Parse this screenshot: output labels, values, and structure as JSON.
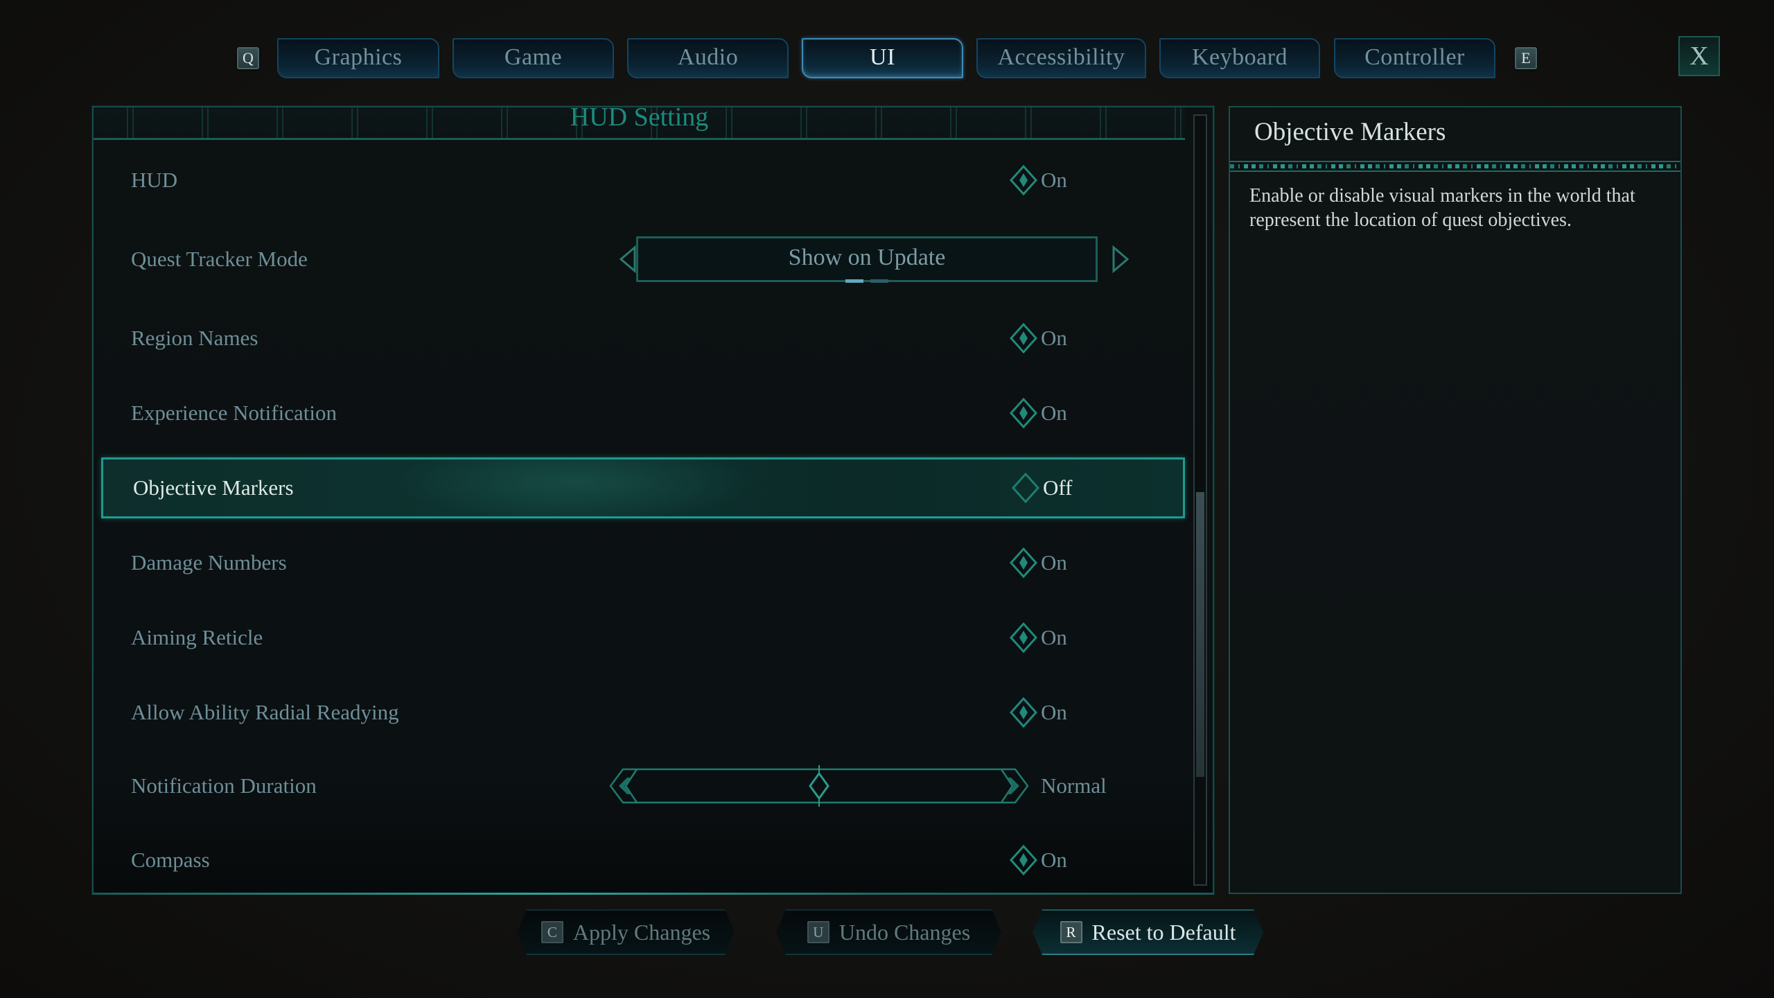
{
  "tabs": {
    "prev_key": "Q",
    "next_key": "E",
    "items": [
      {
        "label": "Graphics",
        "active": false
      },
      {
        "label": "Game",
        "active": false
      },
      {
        "label": "Audio",
        "active": false
      },
      {
        "label": "UI",
        "active": true
      },
      {
        "label": "Accessibility",
        "active": false
      },
      {
        "label": "Keyboard",
        "active": false
      },
      {
        "label": "Controller",
        "active": false
      }
    ],
    "close_label": "X"
  },
  "settings_panel": {
    "section_title": "HUD Setting",
    "rows": [
      {
        "label": "HUD",
        "type": "toggle",
        "value": "On",
        "selected": false
      },
      {
        "label": "Quest Tracker Mode",
        "type": "selector",
        "value": "Show on Update",
        "option_index": 1,
        "option_count": 2,
        "selected": false
      },
      {
        "label": "Region Names",
        "type": "toggle",
        "value": "On",
        "selected": false
      },
      {
        "label": "Experience Notification",
        "type": "toggle",
        "value": "On",
        "selected": false
      },
      {
        "label": "Objective Markers",
        "type": "toggle",
        "value": "Off",
        "selected": true
      },
      {
        "label": "Damage Numbers",
        "type": "toggle",
        "value": "On",
        "selected": false
      },
      {
        "label": "Aiming Reticle",
        "type": "toggle",
        "value": "On",
        "selected": false
      },
      {
        "label": "Allow Ability Radial Readying",
        "type": "toggle",
        "value": "On",
        "selected": false
      },
      {
        "label": "Notification Duration",
        "type": "slider",
        "value": "Normal",
        "slider_fraction": 0.5,
        "selected": false
      },
      {
        "label": "Compass",
        "type": "toggle",
        "value": "On",
        "selected": false
      }
    ],
    "scrollbar": {
      "thumb_start_fraction": 0.49,
      "thumb_end_fraction": 0.86
    }
  },
  "detail_panel": {
    "title": "Objective Markers",
    "description": "Enable or disable visual markers in the world that represent the location of quest objectives."
  },
  "footer": {
    "buttons": [
      {
        "key": "C",
        "label": "Apply Changes",
        "enabled": false
      },
      {
        "key": "U",
        "label": "Undo Changes",
        "enabled": false
      },
      {
        "key": "R",
        "label": "Reset to Default",
        "enabled": true
      }
    ]
  },
  "colors": {
    "accent": "#1f9c8e",
    "tab_active_border": "#3f8ab5",
    "text_muted": "#6e8f98",
    "text_bright": "#dfe9e6"
  }
}
